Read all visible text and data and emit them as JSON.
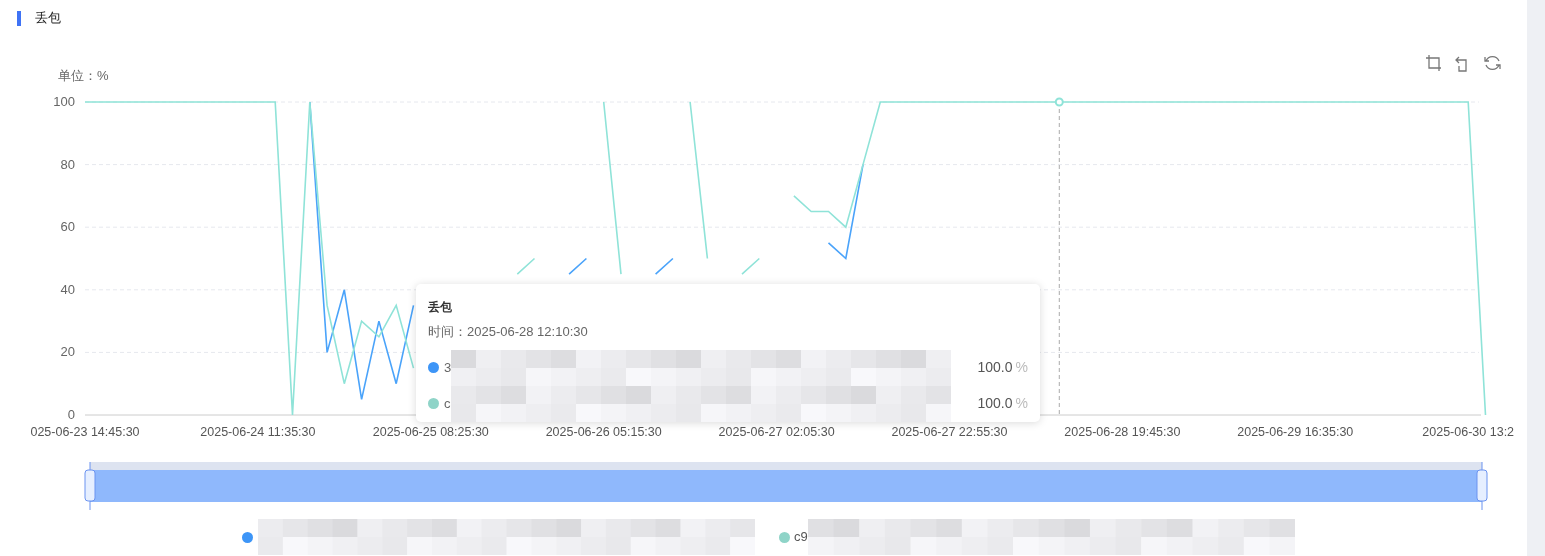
{
  "section": {
    "title": "丢包"
  },
  "toolbar": {
    "buttons": [
      {
        "kind": "zoom"
      },
      {
        "kind": "zoom_back"
      },
      {
        "kind": "restore"
      }
    ]
  },
  "chart": {
    "chart_data": {
      "type": "line",
      "grid": true,
      "ylabel": "单位：%",
      "ylim": [
        0,
        100
      ],
      "yticks": [
        0,
        20,
        40,
        60,
        80,
        100
      ],
      "categories": [
        "025-06-23 14:45:30",
        null,
        null,
        null,
        null,
        null,
        null,
        null,
        null,
        null,
        "2025-06-24 11:35:30",
        null,
        null,
        null,
        null,
        null,
        null,
        null,
        null,
        null,
        "2025-06-25 08:25:30",
        null,
        null,
        null,
        null,
        null,
        null,
        null,
        null,
        null,
        "2025-06-26 05:15:30",
        null,
        null,
        null,
        null,
        null,
        null,
        null,
        null,
        null,
        "2025-06-27 02:05:30",
        null,
        null,
        null,
        null,
        null,
        null,
        null,
        null,
        null,
        "2025-06-27 22:55:30",
        null,
        null,
        null,
        null,
        null,
        null,
        null,
        null,
        null,
        "2025-06-28 19:45:30",
        null,
        null,
        null,
        null,
        null,
        null,
        null,
        null,
        null,
        "2025-06-29 16:35:30",
        null,
        null,
        null,
        null,
        null,
        null,
        null,
        null,
        null,
        "2025-06-30 13:2",
        null
      ],
      "series": [
        {
          "color": "#4aa3fa",
          "values": [
            null,
            null,
            null,
            null,
            null,
            null,
            null,
            null,
            null,
            null,
            null,
            null,
            null,
            100,
            20,
            40,
            5,
            30,
            10,
            35,
            null,
            null,
            null,
            null,
            null,
            null,
            null,
            null,
            45,
            50,
            null,
            null,
            null,
            45,
            50,
            null,
            null,
            null,
            null,
            null,
            null,
            null,
            null,
            55,
            50,
            80,
            null,
            null,
            null,
            null,
            null,
            null,
            null,
            null,
            null,
            null,
            null,
            null,
            null,
            null,
            null,
            null,
            null,
            null,
            null,
            null,
            null,
            null,
            null,
            null,
            null,
            null,
            null,
            null,
            null,
            null,
            null,
            null,
            null,
            null,
            null,
            null
          ]
        },
        {
          "color": "#8fe3d8",
          "values": [
            100,
            100,
            100,
            100,
            100,
            100,
            100,
            100,
            100,
            100,
            100,
            100,
            0,
            100,
            35,
            10,
            30,
            25,
            35,
            15,
            null,
            null,
            null,
            null,
            null,
            45,
            50,
            null,
            null,
            null,
            100,
            45,
            null,
            null,
            null,
            100,
            50,
            null,
            45,
            50,
            null,
            70,
            65,
            65,
            60,
            80,
            100,
            100,
            100,
            100,
            100,
            100,
            100,
            100,
            100,
            100,
            100,
            100,
            100,
            100,
            100,
            100,
            100,
            100,
            100,
            100,
            100,
            100,
            100,
            100,
            100,
            100,
            100,
            100,
            100,
            100,
            100,
            100,
            100,
            100,
            100,
            0
          ]
        }
      ]
    },
    "tooltip": {
      "title": "丢包",
      "time": "时间：2025-06-28 12:10:30",
      "rows": [
        {
          "name_fragment": "3",
          "color": "#3d95f7",
          "value": "100.0",
          "unit": "%"
        },
        {
          "name_fragment": "c",
          "color": "#8fd4c8",
          "value": "100.0",
          "unit": "%"
        }
      ]
    },
    "zoom_slider": {
      "level": 1
    }
  },
  "legend": [
    {
      "color": "#3d95f7"
    },
    {
      "color": "#8fd4c8",
      "name_fragment": "c9"
    }
  ]
}
